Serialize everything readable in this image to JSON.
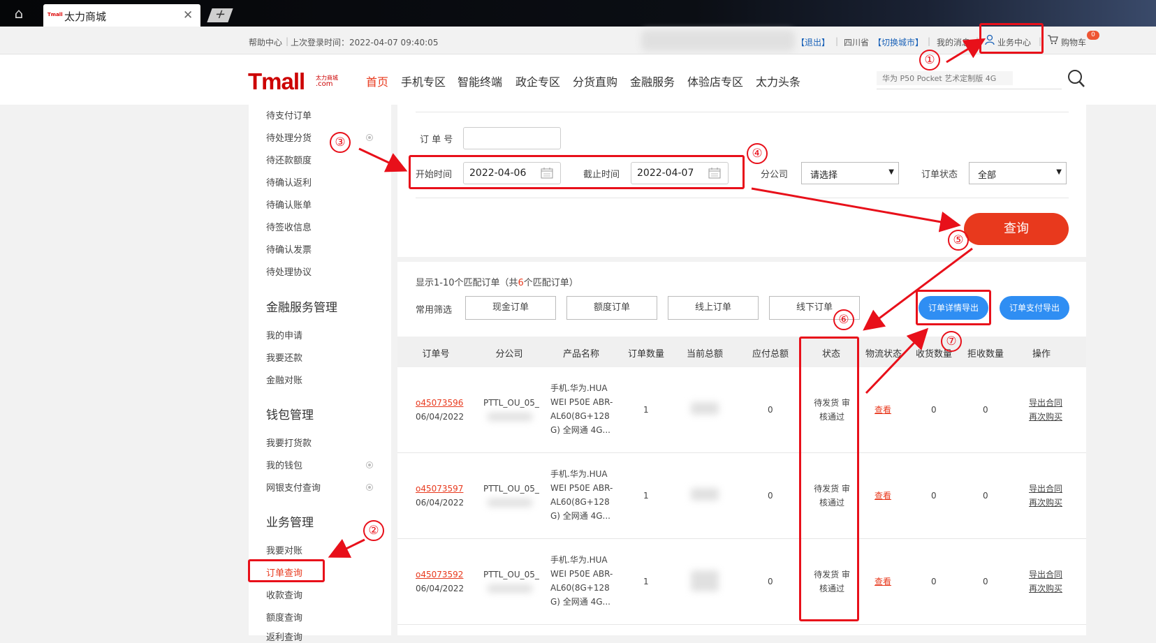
{
  "browser": {
    "home_icon": "home-icon",
    "tab_logo": "Tmall",
    "tab_title": "太力商城",
    "close_symbol": "✕",
    "new_tab_symbol": "+"
  },
  "topbar": {
    "help": "帮助中心",
    "sep": "|",
    "last_login": "上次登录时间：2022-04-07 09:40:05",
    "logout": "【退出】",
    "province": "四川省",
    "switch_city": "【切换城市】",
    "messages": "我的消息",
    "business_center": "业务中心",
    "cart": "购物车",
    "cart_count": "0"
  },
  "header": {
    "logo_main": "Tmall",
    "logo_sub_1": "太力商城",
    "logo_sub_2": ".com",
    "nav": [
      "首页",
      "手机专区",
      "智能终端",
      "政企专区",
      "分货直购",
      "金融服务",
      "体验店专区",
      "太力头条"
    ],
    "active_nav_color": "#e8391d",
    "search_placeholder": "华为 P50 Pocket 艺术定制版 4G"
  },
  "sidebar": {
    "order_items": [
      "待支付订单",
      "待处理分货",
      "待还款额度",
      "待确认返利",
      "待确认账单",
      "待签收信息",
      "待确认发票",
      "待处理协议"
    ],
    "finance_title": "金融服务管理",
    "finance_items": [
      "我的申请",
      "我要还款",
      "金融对账"
    ],
    "wallet_title": "钱包管理",
    "wallet_items": [
      "我要打货款",
      "我的钱包",
      "网银支付查询"
    ],
    "business_title": "业务管理",
    "business_items": [
      "我要对账",
      "订单查询",
      "收款查询",
      "额度查询",
      "返利查询"
    ]
  },
  "filters": {
    "order_no_label": "订 单 号",
    "order_no_value": "",
    "start_label": "开始时间",
    "start_value": "2022-04-06",
    "end_label": "截止时间",
    "end_value": "2022-04-07",
    "branch_label": "分公司",
    "branch_value": "请选择",
    "status_label": "订单状态",
    "status_value": "全部",
    "query_button": "查询"
  },
  "list": {
    "summary_prefix": "显示1-10个匹配订单（共",
    "summary_count": "6",
    "summary_suffix": "个匹配订单）",
    "quick_label": "常用筛选",
    "quick_filters": [
      "现金订单",
      "额度订单",
      "线上订单",
      "线下订单"
    ],
    "export_detail": "订单详情导出",
    "export_payment": "订单支付导出",
    "columns": [
      "订单号",
      "分公司",
      "产品名称",
      "订单数量",
      "当前总额",
      "应付总额",
      "状态",
      "物流状态",
      "收货数量",
      "拒收数量",
      "操作"
    ],
    "rows": [
      {
        "order_no": "o45073596",
        "date": "06/04/2022",
        "branch": "PTTL_OU_05_",
        "product": [
          "手机.华为.HUA",
          "WEI P50E ABR-",
          "AL60(8G+128",
          "G) 全网通 4G..."
        ],
        "qty": "1",
        "payable": "0",
        "status": [
          "待发货 审",
          "核通过"
        ],
        "logistics": "查看",
        "received": "0",
        "rejected": "0",
        "op1": "导出合同",
        "op2": "再次购买"
      },
      {
        "order_no": "o45073597",
        "date": "06/04/2022",
        "branch": "PTTL_OU_05_",
        "product": [
          "手机.华为.HUA",
          "WEI P50E ABR-",
          "AL60(8G+128",
          "G) 全网通 4G..."
        ],
        "qty": "1",
        "payable": "0",
        "status": [
          "待发货 审",
          "核通过"
        ],
        "logistics": "查看",
        "received": "0",
        "rejected": "0",
        "op1": "导出合同",
        "op2": "再次购买"
      },
      {
        "order_no": "o45073592",
        "date": "06/04/2022",
        "branch": "PTTL_OU_05_",
        "product": [
          "手机.华为.HUA",
          "WEI P50E ABR-",
          "AL60(8G+128",
          "G) 全网通 4G..."
        ],
        "qty": "1",
        "payable": "0",
        "status": [
          "待发货 审",
          "核通过"
        ],
        "logistics": "查看",
        "received": "0",
        "rejected": "0",
        "op1": "导出合同",
        "op2": "再次购买"
      }
    ]
  },
  "annotations": {
    "markers": [
      "①",
      "②",
      "③",
      "④",
      "⑤",
      "⑥",
      "⑦"
    ],
    "color": "#e8101a"
  }
}
